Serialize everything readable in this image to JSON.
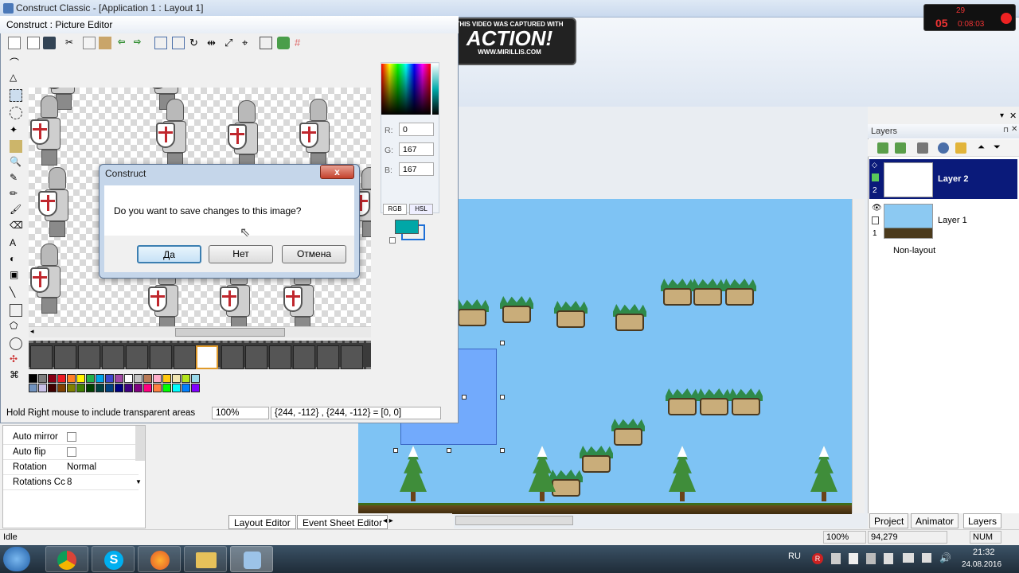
{
  "main_window": {
    "title": "Construct Classic - [Application 1 : Layout 1]"
  },
  "recording": {
    "logo_line1": "THIS VIDEO WAS CAPTURED WITH",
    "logo_word": "ACTION!",
    "logo_url": "WWW.MIRILLIS.COM",
    "fps": "29",
    "elapsed": "05",
    "timer": "0:08:03"
  },
  "picture_editor": {
    "title": "Construct : Picture Editor",
    "status_hint": "Hold Right mouse to include transparent areas",
    "zoom": "100%",
    "coords": "{244, -112} , {244, -112} = [0, 0]",
    "color": {
      "r_label": "R:",
      "g_label": "G:",
      "b_label": "B:",
      "r": "0",
      "g": "167",
      "b": "167",
      "mode_rgb": "RGB",
      "mode_hsl": "HSL",
      "primary": "#00a7a7",
      "secondary": "#1d6fd6"
    }
  },
  "dialog": {
    "title": "Construct",
    "message": "Do you want to save changes to this image?",
    "yes": "Да",
    "no": "Нет",
    "cancel": "Отмена",
    "close": "x"
  },
  "properties": [
    {
      "key": "Auto mirror",
      "type": "checkbox"
    },
    {
      "key": "Auto flip",
      "type": "checkbox"
    },
    {
      "key": "Rotation",
      "value": "Normal"
    },
    {
      "key": "Rotations Cc",
      "value": "8"
    }
  ],
  "editor_tabs": {
    "layout": "Layout Editor",
    "events": "Event Sheet Editor"
  },
  "layers": {
    "header": "Layers",
    "items": [
      {
        "name": "Layer 2",
        "index": "2",
        "selected": true
      },
      {
        "name": "Layer 1",
        "index": "1",
        "selected": false
      }
    ],
    "non_layout": "Non-layout",
    "tabs": [
      "Project",
      "Animator",
      "Layers"
    ]
  },
  "status_bar": {
    "state": "Idle",
    "zoom": "100%",
    "coords": "94,279",
    "num": "NUM"
  },
  "taskbar": {
    "lang": "RU",
    "time": "21:32",
    "date": "24.08.2016"
  },
  "palette": [
    "#000000",
    "#7f7f7f",
    "#880015",
    "#ed1c24",
    "#ff7f27",
    "#fff200",
    "#22b14c",
    "#00a2e8",
    "#3f48cc",
    "#a349a4",
    "#ffffff",
    "#c3c3c3",
    "#b97a57",
    "#ffaec9",
    "#ffc90e",
    "#efe4b0",
    "#b5e61d",
    "#99d9ea",
    "#7092be",
    "#c8bfe7",
    "#400000",
    "#804000",
    "#808000",
    "#408000",
    "#004000",
    "#004040",
    "#004080",
    "#000080",
    "#400080",
    "#800080",
    "#ff0080",
    "#ff8040",
    "#00ff00",
    "#00ffff",
    "#0080ff",
    "#8000ff"
  ]
}
